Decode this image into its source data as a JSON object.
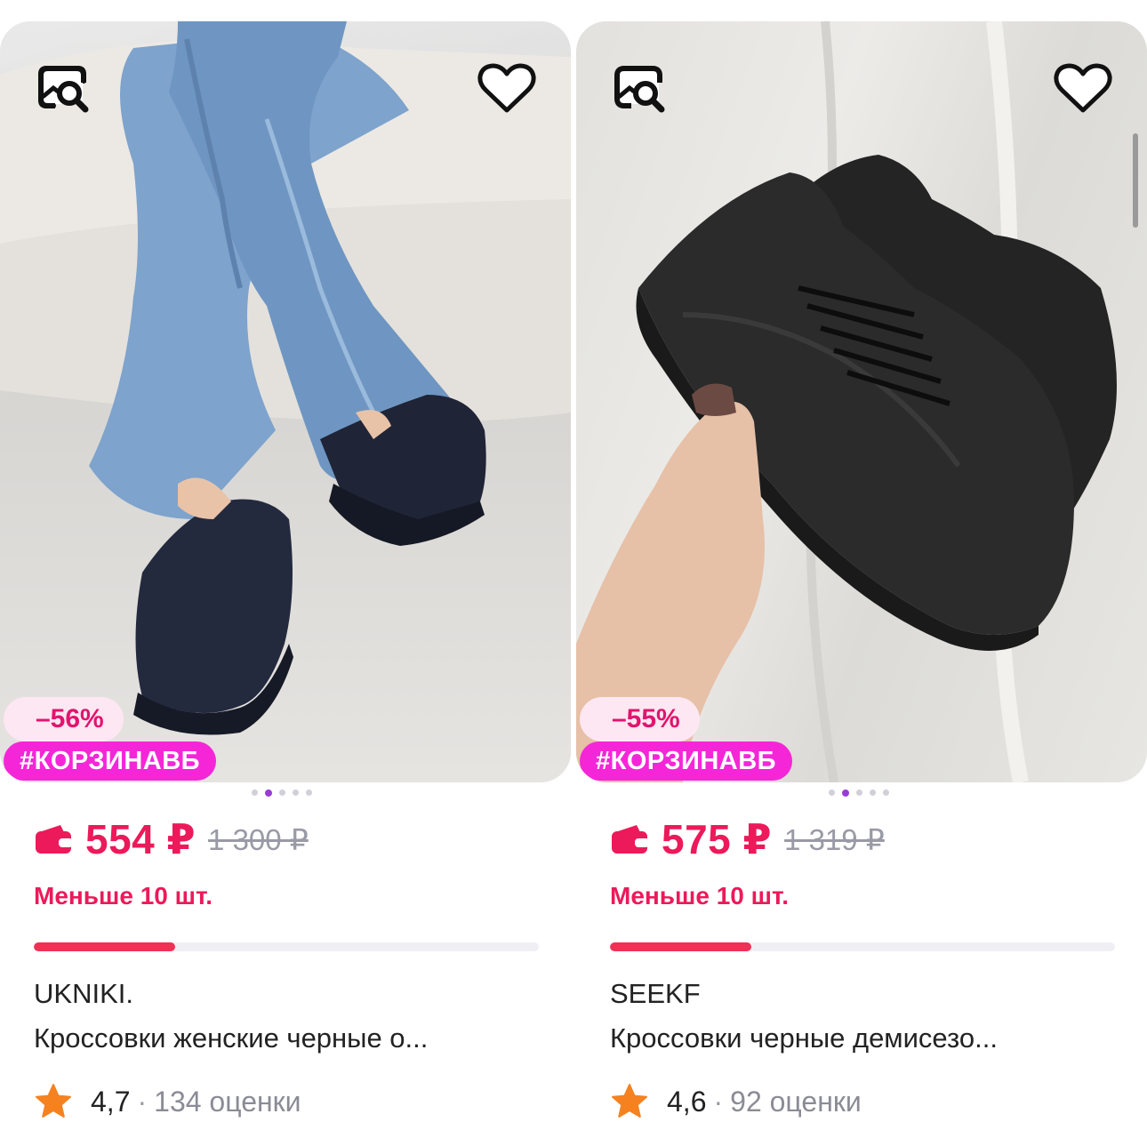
{
  "products": [
    {
      "discount": "–56%",
      "promo_tag": "#КОРЗИНАВБ",
      "price": "554 ₽",
      "old_price": "1 300 ₽",
      "stock_text": "Меньше 10 шт.",
      "stock_level": 0.28,
      "brand": "UKNIKI.",
      "title": "Кроссовки женские черные о...",
      "rating": "4,7",
      "separator": "·",
      "reviews": "134 оценки",
      "image_count": 5,
      "active_image": 2
    },
    {
      "discount": "–55%",
      "promo_tag": "#КОРЗИНАВБ",
      "price": "575 ₽",
      "old_price": "1 319 ₽",
      "stock_text": "Меньше 10 шт.",
      "stock_level": 0.28,
      "brand": "SEEKF",
      "title": "Кроссовки черные демисезо...",
      "rating": "4,6",
      "separator": "·",
      "reviews": "92 оценки",
      "image_count": 5,
      "active_image": 2
    }
  ],
  "colors": {
    "accent_price": "#ec1a5a",
    "promo_tag_bg": "#f526d8",
    "discount_bg": "#fde7f2",
    "progress_fill": "#ef3155",
    "star": "#f5821f",
    "dot_active": "#9b3bd6"
  },
  "icons": {
    "search": "image-search-icon",
    "favorite": "heart-icon",
    "wallet": "wallet-icon",
    "rating": "star-icon"
  }
}
